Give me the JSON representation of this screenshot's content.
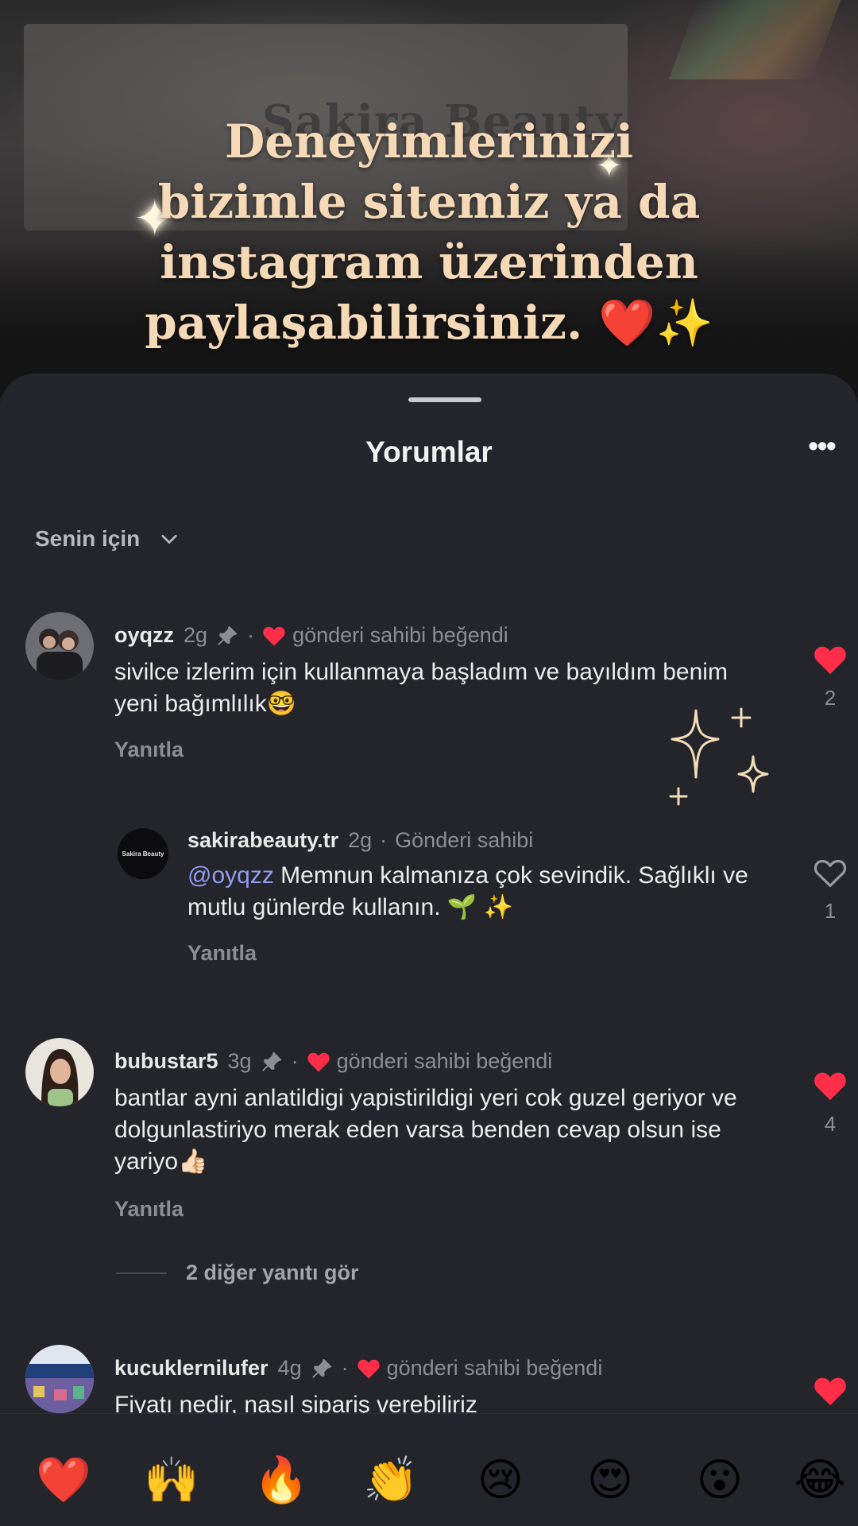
{
  "story": {
    "headline_lines": [
      "Deneyimlerinizi",
      "bizimle sitemiz ya da",
      "instagram üzerinden",
      "paylaşabilirsiniz. ❤️✨"
    ],
    "background_brand_text": "Sakira Beauty"
  },
  "sheet": {
    "title": "Yorumlar",
    "more_label": "•••",
    "filter_label": "Senin için"
  },
  "comments": [
    {
      "user": "oyqzz",
      "time": "2g",
      "liked_by_author": "gönderi sahibi beğendi",
      "text": "sivilce izlerim için kullanmaya başladım ve bayıldım benim yeni bağımlılık🤓",
      "reply_label": "Yanıtla",
      "likes": "2",
      "liked": true
    },
    {
      "user": "sakirabeauty.tr",
      "time": "2g",
      "role": "Gönderi sahibi",
      "avatar_text": "Sakira Beauty",
      "mention": "@oyqzz",
      "text": "Memnun kalmanıza çok sevindik. Sağlıklı ve mutlu günlerde kullanın. 🌱 ✨",
      "reply_label": "Yanıtla",
      "likes": "1",
      "liked": false
    },
    {
      "user": "bubustar5",
      "time": "3g",
      "liked_by_author": "gönderi sahibi beğendi",
      "text": "bantlar ayni anlatildigi yapistirildigi yeri cok guzel geriyor ve dolgunlastiriyo merak eden varsa benden cevap olsun ise yariyo👍🏻",
      "reply_label": "Yanıtla",
      "likes": "4",
      "liked": true,
      "more_replies": "2 diğer yanıtı gör"
    },
    {
      "user": "kucuklernilufer",
      "time": "4g",
      "liked_by_author": "gönderi sahibi beğendi",
      "text": "Fiyatı nedir, nasıl sipariş verebiliriz",
      "liked": true
    }
  ],
  "emoji_bar": [
    "❤️",
    "🙌",
    "🔥",
    "👏",
    "😢",
    "😍",
    "😮",
    "😂"
  ],
  "colors": {
    "sheet_bg": "#24252b",
    "like_red": "#ff2d48",
    "mention_blue": "#8f9cf0",
    "headline": "#f6d9b7"
  }
}
